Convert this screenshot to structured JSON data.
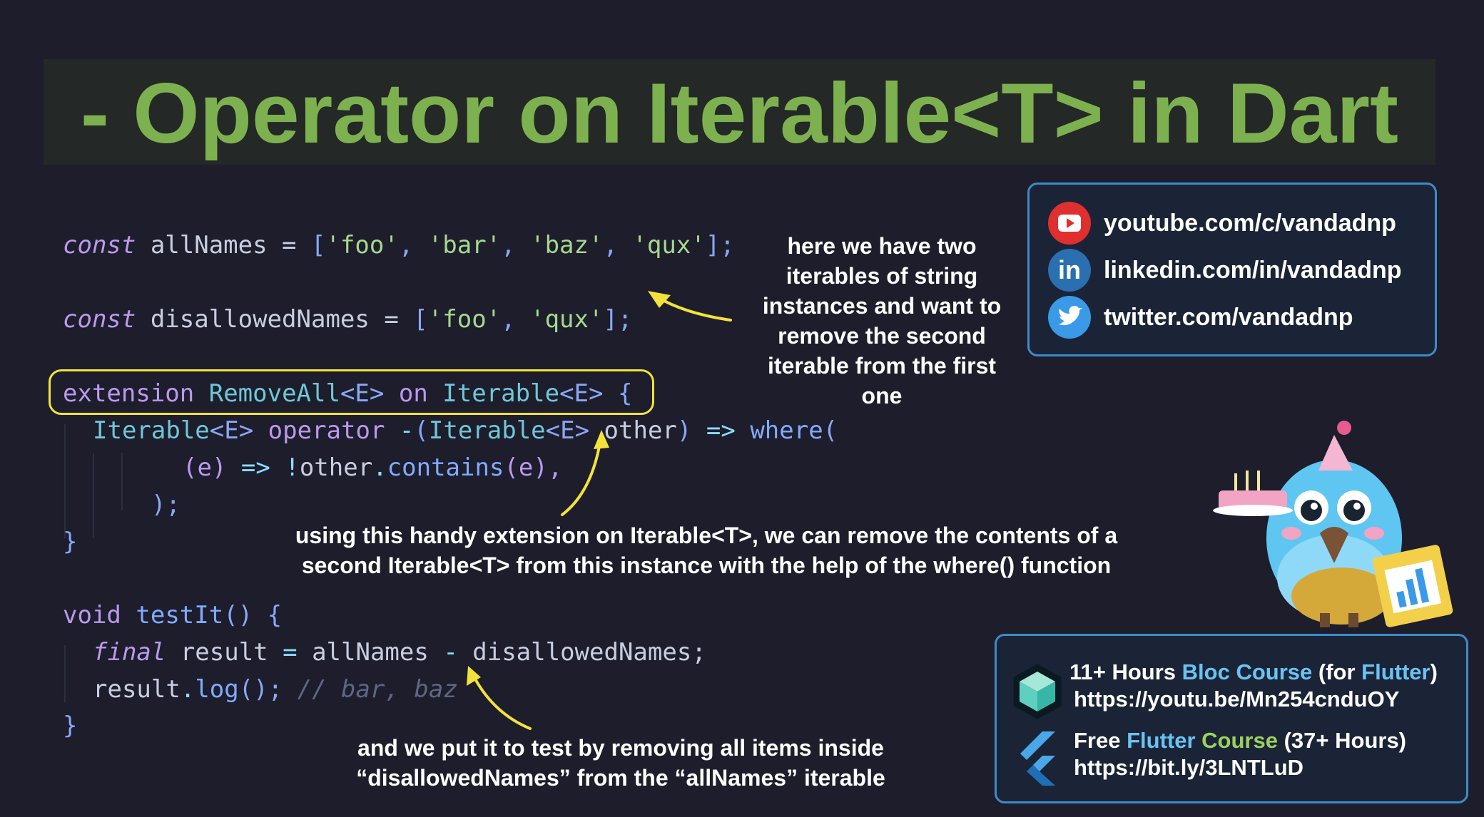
{
  "title": "- Operator on Iterable<T> in Dart",
  "code": {
    "line1": {
      "kw": "const",
      "name": " allNames = ",
      "open": "[",
      "s1": "'foo'",
      "s2": "'bar'",
      "s3": "'baz'",
      "s4": "'qux'",
      "close": "];",
      "comma": ", "
    },
    "line2": {
      "kw": "const",
      "name": " disallowedNames = ",
      "open": "[",
      "s1": "'foo'",
      "s2": "'qux'",
      "close": "];",
      "comma": ", "
    },
    "line3": {
      "kw": "extension",
      "name": "RemoveAll",
      "gen1": "<E>",
      "on": "on",
      "type": "Iterable",
      "gen2": "<E>",
      "brace": "{"
    },
    "line4": {
      "type1": "Iterable",
      "gen1": "<E>",
      "operator": "operator",
      "minus": "-",
      "paren": "(",
      "type2": "Iterable",
      "gen2": "<E>",
      "other": " other",
      "close": ")",
      "arrow": "=>",
      "where": "where",
      "open": "("
    },
    "line5": {
      "param": "(e)",
      "arrow": "=>",
      "not": "!",
      "other": "other",
      "dot": ".",
      "contains": "contains",
      "args": "(e),"
    },
    "line6": ");",
    "line7": "}",
    "line8": {
      "kw": "void",
      "fn": "testIt",
      "rest": "() {"
    },
    "line9": {
      "kw": "final",
      "rest1": " result ",
      "eq": "=",
      "rest2": " allNames ",
      "minus": "-",
      "rest3": " disallowedNames;"
    },
    "line10": {
      "obj": "result",
      "dot": ".",
      "fn": "log",
      "rest": "();",
      "comment": "// bar, baz"
    },
    "line11": "}"
  },
  "notes": {
    "note1": [
      "here we have two",
      "iterables of string",
      "instances and want to",
      "remove the second",
      "iterable from the first",
      "one"
    ],
    "note2": [
      "using this handy extension on Iterable<T>, we can remove the contents of a",
      "second Iterable<T> from this instance with the help of the where() function"
    ],
    "note3": [
      "and we put it to test by removing all items inside",
      "“disallowedNames” from the “allNames” iterable"
    ]
  },
  "social": {
    "youtube": "youtube.com/c/vandadnp",
    "linkedin": "linkedin.com/in/vandadnp",
    "twitter": "twitter.com/vandadnp",
    "linkedin_glyph": "in"
  },
  "courses": {
    "bloc": {
      "prefix": "11+ Hours ",
      "highlight": "Bloc Course",
      "mid": " (for ",
      "flutter": "Flutter",
      "end": ")",
      "url": "https://youtu.be/Mn254cnduOY"
    },
    "flutter": {
      "prefix": "Free ",
      "hl1": "Flutter",
      "space": " ",
      "hl2": "Course",
      "end": " (37+ Hours)",
      "url": "https://bit.ly/3LNTLuD"
    }
  },
  "colors": {
    "background": "#1d1d2c",
    "title": "#7db14f",
    "highlight_box": "#f2e33a",
    "card_border": "#3d8bc7"
  },
  "icons": [
    "youtube-icon",
    "linkedin-icon",
    "twitter-icon",
    "bloc-cube-icon",
    "flutter-icon",
    "dash-mascot-icon"
  ]
}
